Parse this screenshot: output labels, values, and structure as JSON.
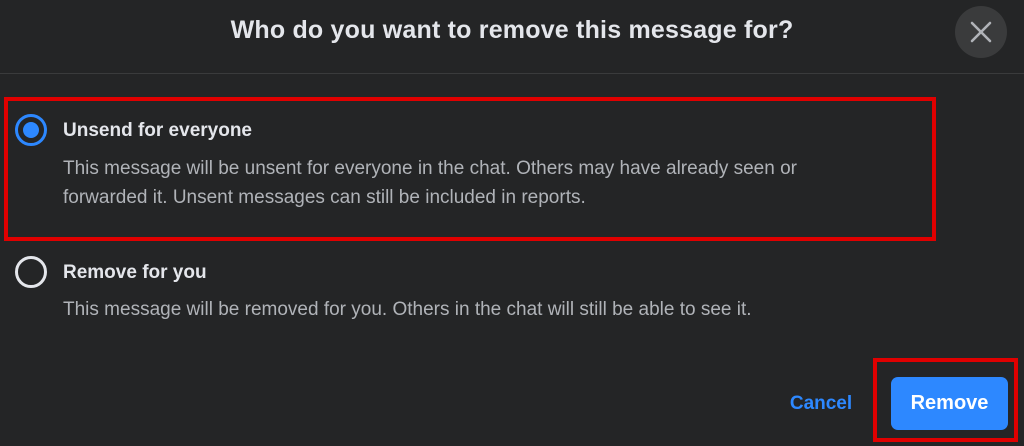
{
  "dialog": {
    "title": "Who do you want to remove this message for?",
    "close_icon": "close-icon"
  },
  "options": [
    {
      "title": "Unsend for everyone",
      "description_line1": "This message will be unsent for everyone in the chat. Others may have already seen or",
      "description_line2": "forwarded it. Unsent messages can still be included in reports.",
      "selected": true
    },
    {
      "title": "Remove for you",
      "description_line1": "This message will be removed for you. Others in the chat will still be able to see it.",
      "selected": false
    }
  ],
  "actions": {
    "cancel_label": "Cancel",
    "remove_label": "Remove"
  },
  "colors": {
    "background": "#242526",
    "accent": "#2d88ff",
    "highlight_annotation": "#e00000",
    "primary_text": "#e4e6eb",
    "secondary_text": "#b0b3b8"
  }
}
